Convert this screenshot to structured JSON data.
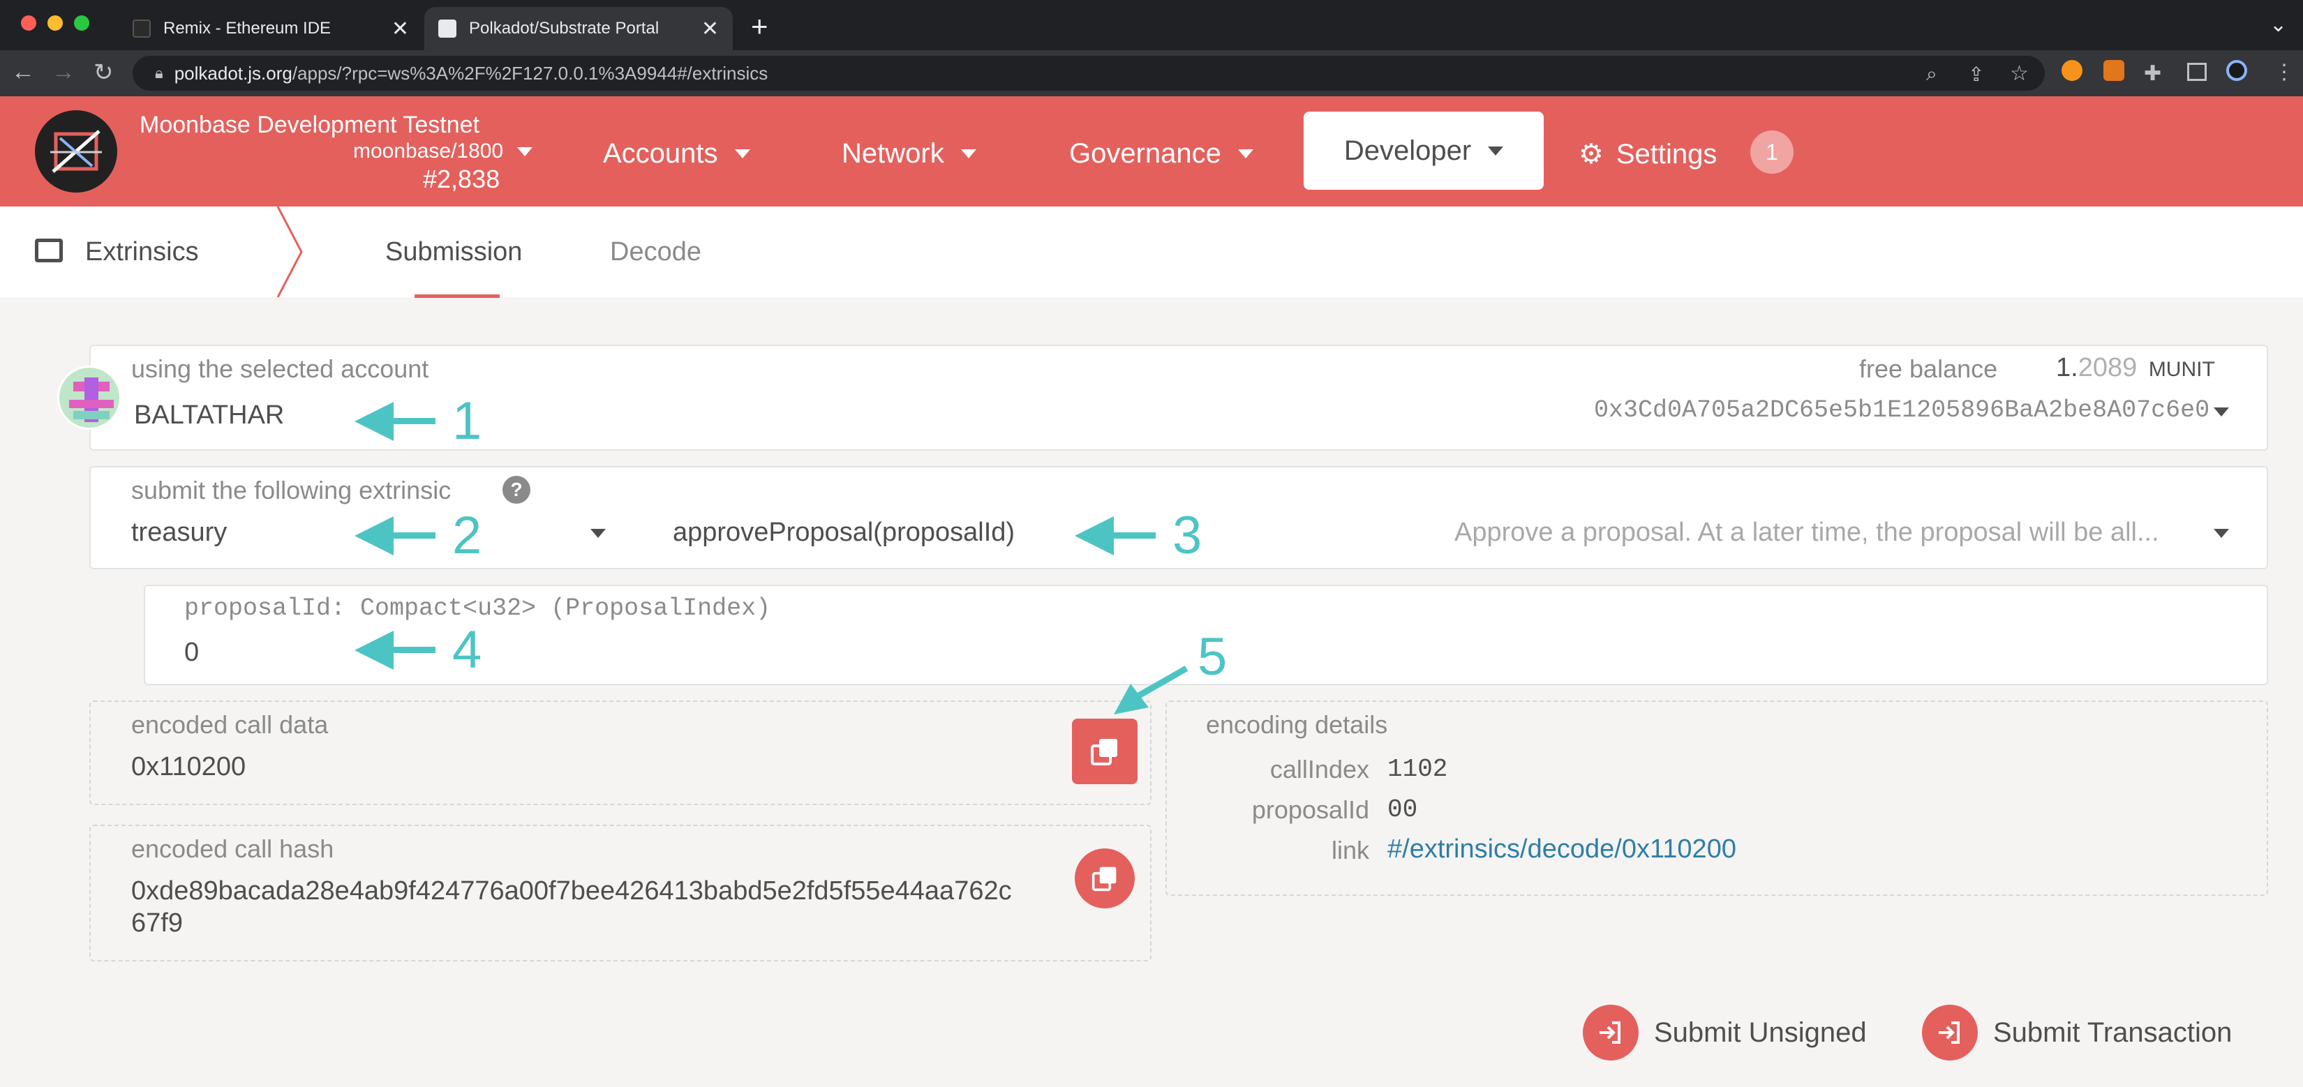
{
  "browser": {
    "tabs": [
      {
        "title": "Remix - Ethereum IDE"
      },
      {
        "title": "Polkadot/Substrate Portal"
      }
    ],
    "url_host": "polkadot.js.org",
    "url_path": "/apps/?rpc=ws%3A%2F%2F127.0.0.1%3A9944#/extrinsics"
  },
  "header": {
    "network_name": "Moonbase Development Testnet",
    "chain_version": "moonbase/1800",
    "block_number": "#2,838",
    "menus": {
      "accounts": "Accounts",
      "network": "Network",
      "governance": "Governance",
      "developer": "Developer",
      "settings": "Settings"
    },
    "settings_badge": "1"
  },
  "subnav": {
    "section": "Extrinsics",
    "tabs": [
      "Submission",
      "Decode"
    ]
  },
  "account": {
    "label": "using the selected account",
    "name": "BALTATHAR",
    "free_balance_label": "free balance",
    "balance_int": "1.",
    "balance_frac": "2089",
    "balance_unit": "MUNIT",
    "address": "0x3Cd0A705a2DC65e5b1E1205896BaA2be8A07c6e0"
  },
  "extrinsic": {
    "label": "submit the following extrinsic",
    "help": "?",
    "pallet": "treasury",
    "method": "approveProposal(proposalId)",
    "description": "Approve a proposal. At a later time, the proposal will be all..."
  },
  "param": {
    "label": "proposalId: Compact<u32> (ProposalIndex)",
    "value": "0"
  },
  "encoded_call_data": {
    "label": "encoded call data",
    "value": "0x110200"
  },
  "encoded_call_hash": {
    "label": "encoded call hash",
    "line1": "0xde89bacada28e4ab9f424776a00f7bee426413babd5e2fd5f55e44aa762c",
    "line2": "67f9"
  },
  "encoding_details": {
    "label": "encoding details",
    "rows": [
      {
        "key": "callIndex",
        "value": "1102"
      },
      {
        "key": "proposalId",
        "value": "00"
      },
      {
        "key": "link",
        "value": "#/extrinsics/decode/0x110200"
      }
    ]
  },
  "annotations": [
    "1",
    "2",
    "3",
    "4",
    "5"
  ],
  "actions": {
    "submit_unsigned": "Submit Unsigned",
    "submit_transaction": "Submit Transaction"
  },
  "colors": {
    "brand": "#e4605d",
    "annotation": "#4dc4c4",
    "link": "#2f7ea6"
  }
}
